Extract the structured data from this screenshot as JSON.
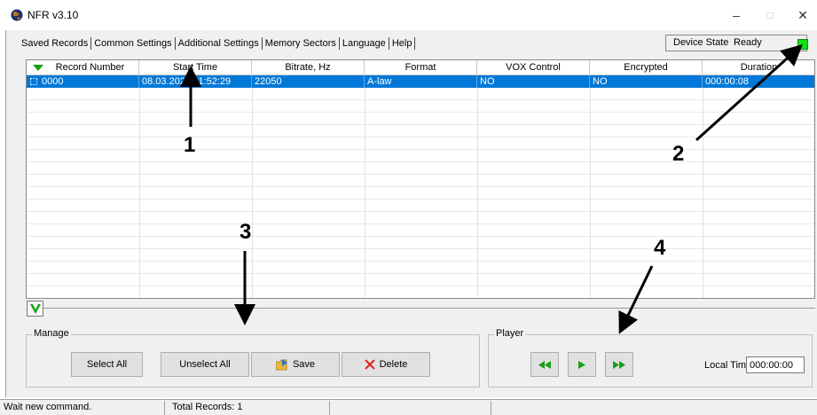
{
  "window": {
    "title": "NFR v3.10",
    "minimize_glyph": "–",
    "maximize_glyph": "□",
    "close_glyph": "✕"
  },
  "tabs": [
    {
      "label": "Saved Records"
    },
    {
      "label": "Common Settings"
    },
    {
      "label": "Additional Settings"
    },
    {
      "label": "Memory Sectors"
    },
    {
      "label": "Language"
    },
    {
      "label": "Help"
    }
  ],
  "device_state": {
    "label": "Device State",
    "value": "Ready",
    "indicator_color": "#16e016"
  },
  "table": {
    "columns": [
      "Record Number",
      "Start Time",
      "Bitrate, Hz",
      "Format",
      "VOX Control",
      "Encrypted",
      "Duration"
    ],
    "rows": [
      [
        "0000",
        "08.03.2024 11:52:29",
        "22050",
        "A-law",
        "NO",
        "NO",
        "000:00:08"
      ]
    ],
    "selection_color": "#0078d7"
  },
  "manage": {
    "title": "Manage",
    "select_all": "Select All",
    "unselect_all": "Unselect All",
    "save": "Save",
    "delete": "Delete"
  },
  "player": {
    "title": "Player",
    "local_time_label": "Local Time",
    "local_time_value": "000:00:00"
  },
  "status": {
    "message": "Wait new command.",
    "total_records": "Total Records: 1"
  },
  "annotations": [
    "1",
    "2",
    "3",
    "4"
  ],
  "icons": {
    "app": "globe-icon",
    "sort": "sort-desc-icon",
    "collapse": "chevron-down-icon",
    "save": "folder-save-icon",
    "delete": "red-x-icon",
    "rewind": "rewind-icon",
    "play": "play-icon",
    "fast_forward": "fast-forward-icon"
  }
}
